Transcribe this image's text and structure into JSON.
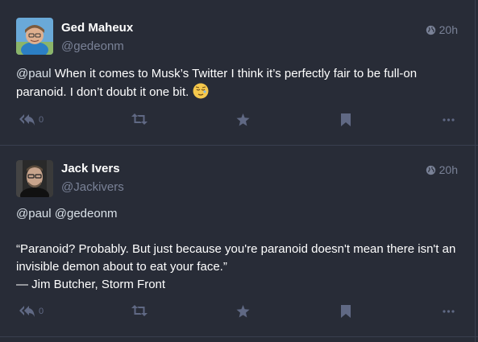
{
  "statuses": [
    {
      "display_name": "Ged Maheux",
      "acct": "@gedeonm",
      "time": "20h",
      "content": {
        "mention": "@paul",
        "text": " When it comes to Musk’s Twitter I think it’s perfectly fair to be full-on paranoid. I don’t doubt it one bit. "
      },
      "emoji": "relieved-face-emoji",
      "reply_count": "0"
    },
    {
      "display_name": "Jack Ivers",
      "acct": "@Jackivers",
      "time": "20h",
      "content": {
        "mention_line": "@paul @gedeonm",
        "quote": "“Paranoid? Probably. But just because you're paranoid doesn't mean there isn't an invisible demon about to eat your face.”",
        "attribution": "— Jim Butcher, Storm Front"
      },
      "reply_count": "0"
    }
  ],
  "icons": {
    "globe": "globe-icon",
    "reply": "reply-all-icon",
    "boost": "retweet-icon",
    "favourite": "star-icon",
    "bookmark": "bookmark-icon",
    "more": "ellipsis-icon"
  },
  "colors": {
    "background": "#282c37",
    "muted": "#7a8297",
    "action": "#606984",
    "divider": "#393f4f"
  }
}
